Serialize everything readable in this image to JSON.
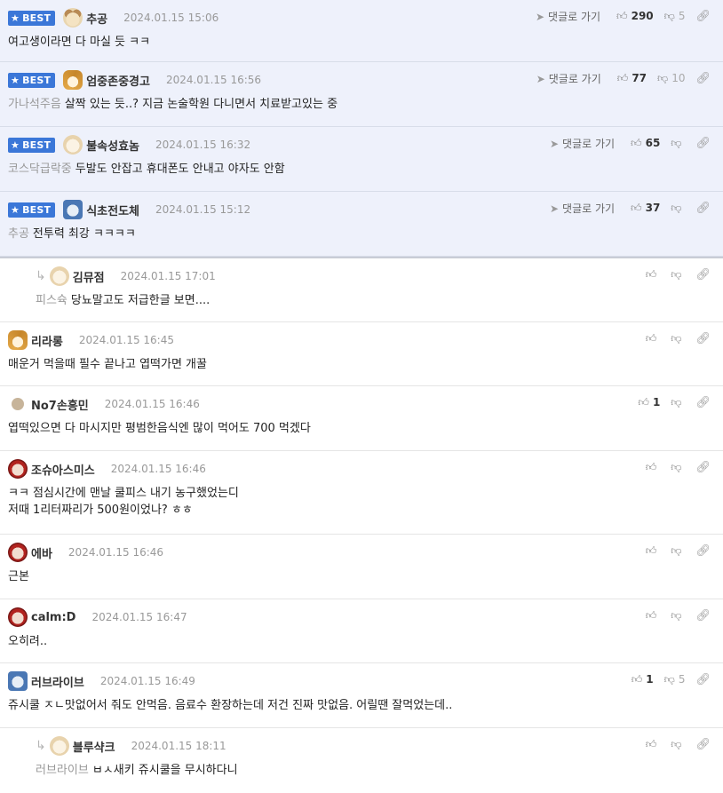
{
  "actions": {
    "goto_reply_label": "댓글로 가기",
    "best_label": "BEST"
  },
  "comments": [
    {
      "best": true,
      "avatar": "dog",
      "nick": "추공",
      "date": "2024.01.15 15:06",
      "mention": "",
      "text": "여고생이라면 다 마실 듯 ㅋㅋ",
      "up": "290",
      "down": "5"
    },
    {
      "best": true,
      "avatar": "fox",
      "nick": "엄중존중경고",
      "date": "2024.01.15 16:56",
      "mention": "가나석주음",
      "text": "살짝 있는 듯..? 지금 논술학원 다니면서 치료받고있는 중",
      "up": "77",
      "down": "10"
    },
    {
      "best": true,
      "avatar": "puppy",
      "nick": "불속성효놈",
      "date": "2024.01.15 16:32",
      "mention": "코스닥급락중",
      "text": "두발도 안잡고 휴대폰도 안내고 야자도 안함",
      "up": "65",
      "down": ""
    },
    {
      "best": true,
      "avatar": "blue",
      "nick": "식초전도체",
      "date": "2024.01.15 15:12",
      "mention": "추공",
      "text": "전투력 최강 ㅋㅋㅋㅋ",
      "up": "37",
      "down": ""
    },
    {
      "reply": true,
      "avatar": "puppy",
      "nick": "김뮤점",
      "date": "2024.01.15 17:01",
      "mention": "피스슉",
      "text": "당뇨말고도 저급한글 보면....",
      "up": "",
      "down": ""
    },
    {
      "avatar": "fox",
      "nick": "리라롱",
      "date": "2024.01.15 16:45",
      "mention": "",
      "text": "매운거 먹을때 필수 끝나고 엽떡가면 개꿀",
      "up": "",
      "down": ""
    },
    {
      "avatar": "dot",
      "nick": "No7손흥민",
      "date": "2024.01.15 16:46",
      "mention": "",
      "text": "엽떡있으면 다 마시지만 평범한음식엔 많이 먹어도 700 먹겠다",
      "up": "1",
      "down": ""
    },
    {
      "avatar": "bear",
      "nick": "조슈아스미스",
      "date": "2024.01.15 16:46",
      "mention": "",
      "text": "ㅋㅋ 점심시간에 맨날 쿨피스 내기 농구했었는디",
      "text2": "저때 1리터짜리가 500원이었나? ㅎㅎ",
      "up": "",
      "down": ""
    },
    {
      "avatar": "bear",
      "nick": "에바",
      "date": "2024.01.15 16:46",
      "mention": "",
      "text": "근본",
      "up": "",
      "down": ""
    },
    {
      "avatar": "bear",
      "nick": "calm:D",
      "date": "2024.01.15 16:47",
      "mention": "",
      "text": "오히려..",
      "up": "",
      "down": ""
    },
    {
      "avatar": "blue",
      "nick": "러브라이브",
      "date": "2024.01.15 16:49",
      "mention": "",
      "text": "쥬시쿨 ㅈㄴ맛없어서 줘도 안먹음. 음료수 환장하는데 저건 진짜 맛없음. 어릴땐 잘먹었는데..",
      "up": "1",
      "down": "5"
    },
    {
      "reply": true,
      "avatar": "puppy",
      "nick": "블루샥크",
      "date": "2024.01.15 18:11",
      "mention": "러브라이브",
      "text": "ㅂㅅ새키 쥬시쿨을 무시하다니",
      "up": "",
      "down": ""
    }
  ]
}
